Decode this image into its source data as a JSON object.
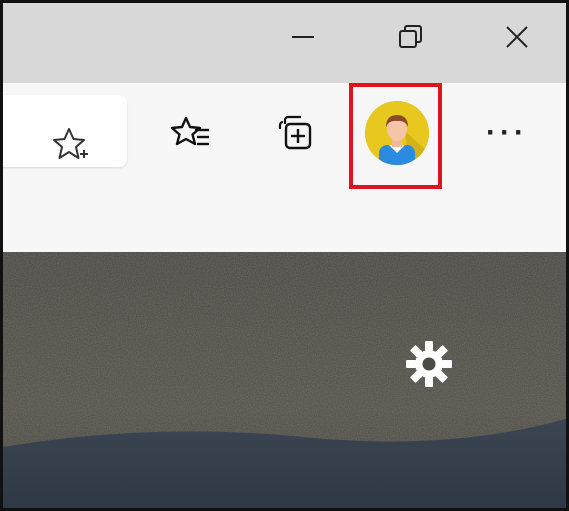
{
  "window_controls": {
    "minimize_icon": "minimize-icon",
    "restore_icon": "restore-icon",
    "close_icon": "close-icon"
  },
  "toolbar": {
    "icons": {
      "add_favorite": "star-add-icon",
      "favorites": "favorites-icon",
      "collections": "collections-icon",
      "profile": "profile-avatar-icon",
      "more": "more-icon"
    },
    "more_label": "···"
  },
  "page": {
    "settings_icon": "gear-icon"
  },
  "colors": {
    "highlight": "#e0121e",
    "profile_bg": "#e8c81f",
    "titlebar": "#d8d8d8",
    "toolbar": "#f7f7f7"
  }
}
